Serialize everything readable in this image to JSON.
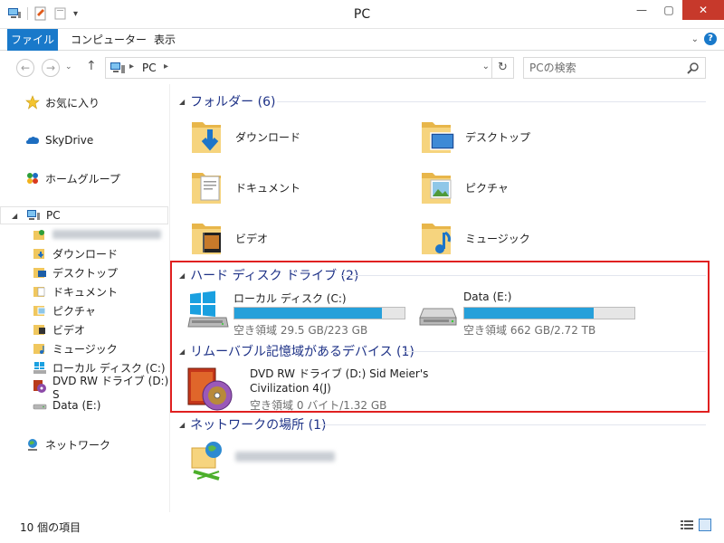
{
  "window": {
    "title": "PC",
    "controls": {
      "minimize": "—",
      "maximize": "▢",
      "close": "✕"
    }
  },
  "ribbon": {
    "tabs": [
      "ファイル",
      "コンピューター",
      "表示"
    ],
    "expand": "⌄",
    "help": "?"
  },
  "nav": {
    "back": "←",
    "forward": "→",
    "recent": "⌄",
    "up": "↑",
    "breadcrumb_sep1": "▸",
    "breadcrumb": "PC",
    "breadcrumb_sep2": "▸",
    "address_dropdown": "⌄",
    "refresh": "↻",
    "search_placeholder": "PCの検索"
  },
  "navpane": {
    "favorites": "お気に入り",
    "skydrive": "SkyDrive",
    "homegroup": "ホームグループ",
    "pc": "PC",
    "pc_children": [
      "ダウンロード",
      "デスクトップ",
      "ドキュメント",
      "ピクチャ",
      "ビデオ",
      "ミュージック",
      "ローカル ディスク (C:)",
      "DVD RW ドライブ (D:) S",
      "Data (E:)"
    ],
    "network": "ネットワーク"
  },
  "groups": {
    "folders_header": "フォルダー (6)",
    "folders": [
      "ダウンロード",
      "デスクトップ",
      "ドキュメント",
      "ピクチャ",
      "ビデオ",
      "ミュージック"
    ],
    "hdd_header": "ハード ディスク ドライブ (2)",
    "drives": [
      {
        "name": "ローカル ディスク (C:)",
        "free": "空き領域 29.5 GB/223 GB",
        "used_fraction": 0.868
      },
      {
        "name": "Data (E:)",
        "free": "空き領域 662 GB/2.72 TB",
        "used_fraction": 0.762
      }
    ],
    "removable_header": "リムーバブル記憶域があるデバイス (1)",
    "dvd": {
      "name_line1": "DVD RW ドライブ (D:) Sid Meier's",
      "name_line2": "Civilization 4(J)",
      "free": "空き領域 0 バイト/1.32 GB"
    },
    "network_header": "ネットワークの場所 (1)"
  },
  "status": {
    "count": "10 個の項目"
  },
  "colors": {
    "accent": "#1979ca",
    "header_text": "#1e3287",
    "drive_fill": "#26a0da",
    "highlight_box": "#e02020",
    "close_button": "#c7392b"
  }
}
